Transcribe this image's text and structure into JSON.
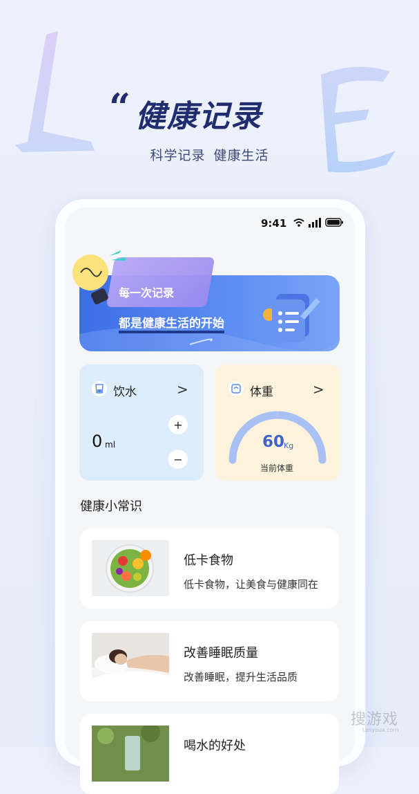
{
  "hero": {
    "quote_mark": "“",
    "title": "健康记录",
    "subtitle_left": "科学记录",
    "subtitle_right": "健康生活"
  },
  "status_bar": {
    "time": "9:41"
  },
  "banner": {
    "line1": "每一次记录",
    "line2": "都是健康生活的开始"
  },
  "water_card": {
    "title": "饮水",
    "arrow": ">",
    "value": "0",
    "unit": "ml",
    "plus_label": "+",
    "minus_label": "−",
    "icon": "cup-icon"
  },
  "weight_card": {
    "title": "体重",
    "arrow": ">",
    "value": "60",
    "unit": "Kg",
    "label": "当前体重",
    "icon": "scale-icon"
  },
  "tips": {
    "section_title": "健康小常识",
    "items": [
      {
        "title": "低卡食物",
        "desc": "低卡食物，让美食与健康同在",
        "image": "salad-bowl-image"
      },
      {
        "title": "改善睡眠质量",
        "desc": "改善睡眠，提升生活品质",
        "image": "sleeping-woman-image"
      },
      {
        "title": "喝水的好处",
        "desc": "",
        "image": "water-glass-image"
      }
    ]
  },
  "watermark": {
    "text": "搜游戏",
    "sub": "Lesyoux.com"
  },
  "colors": {
    "title": "#1f2d6e",
    "banner_start": "#3b6de6",
    "water_bg": "#dcecfb",
    "weight_bg": "#fdf3dc",
    "gauge": "#a9c0f5",
    "weight_value": "#3f63c8"
  }
}
